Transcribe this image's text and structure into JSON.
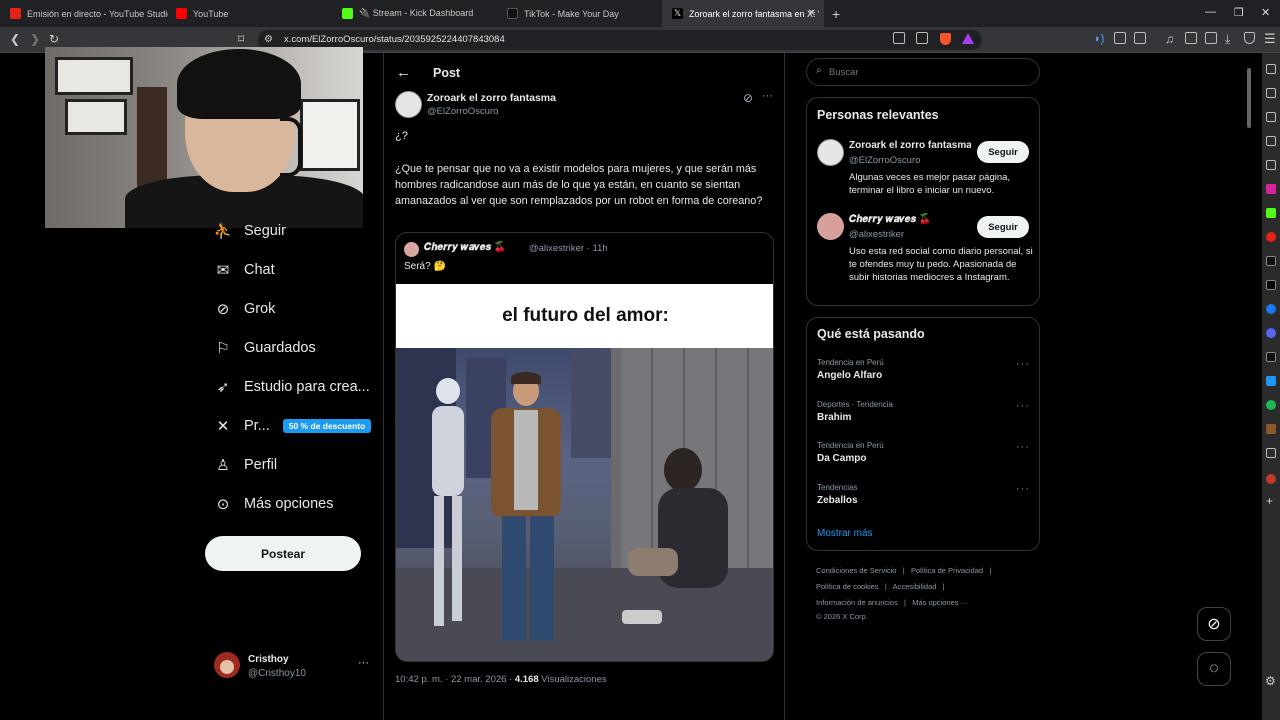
{
  "tabs": [
    {
      "label": "Emisión en directo - YouTube Studio",
      "color": "#e62117"
    },
    {
      "label": "YouTube",
      "color": "#ff0000"
    },
    {
      "label": "🔌 Stream - Kick Dashboard",
      "color": "#53fc18"
    },
    {
      "label": "TikTok - Make Your Day",
      "color": "#111111"
    },
    {
      "label": "Zoroark el zorro fantasma en X: \"",
      "color": "#000000"
    }
  ],
  "address": {
    "url": "x.com/ElZorroOscuro/status/2035925224407843084"
  },
  "nav": [
    {
      "label": "Seguir",
      "icon": "person-plus-icon"
    },
    {
      "label": "Chat",
      "icon": "mail-icon"
    },
    {
      "label": "Grok",
      "icon": "grok-icon"
    },
    {
      "label": "Guardados",
      "icon": "bookmark-icon"
    },
    {
      "label": "Estudio para crea...",
      "icon": "rocket-icon"
    },
    {
      "label": "Pr...",
      "icon": "x-logo-icon"
    },
    {
      "label": "Perfil",
      "icon": "person-icon"
    },
    {
      "label": "Más opciones",
      "icon": "more-circle-icon"
    }
  ],
  "promo_badge": "50 % de descuento",
  "post_button": "Postear",
  "account": {
    "name": "Cristhoy",
    "handle": "@Cristhoy10"
  },
  "post": {
    "header": "Post",
    "author_name": "Zoroark el zorro fantasma",
    "author_handle": "@ElZorroOscuro",
    "line1": "¿?",
    "body": "¿Que te pensar que no va a existir modelos para mujeres, y que serán más hombres radicandose aun más de lo que ya están, en cuanto se sientan amanazados al ver que son remplazados por un robot en forma de coreano?",
    "meta_time": "10:42 p. m. · 22 mar. 2026 · ",
    "views_count": "4.168",
    "views_label": " Visualizaciones"
  },
  "quote": {
    "name": "𝑪𝒉𝒆𝒓𝒓𝒚 𝒘𝒂𝒗𝒆𝒔 🍒",
    "handle_time": "@alixestriker · 11h",
    "text": "Será? 🤔",
    "image_caption": "el futuro del amor:"
  },
  "search": {
    "placeholder": "Buscar"
  },
  "relevant": {
    "title": "Personas relevantes",
    "people": [
      {
        "name": "Zoroark el zorro fantasma...",
        "handle": "@ElZorroOscuro",
        "bio": "Algunas veces es mejor pasar página, terminar el libro e iniciar un nuevo.",
        "button": "Seguir"
      },
      {
        "name": "𝑪𝒉𝒆𝒓𝒓𝒚 𝒘𝒂𝒗𝒆𝒔 🍒",
        "handle": "@alixestriker",
        "bio": "Uso esta red social como diario personal, si te ofendes muy tu pedo. Apasionada de subir historias mediocres a Instagram.",
        "button": "Seguir"
      }
    ]
  },
  "trends": {
    "title": "Qué está pasando",
    "items": [
      {
        "context": "Tendencia en Perú",
        "name": "Angelo Alfaro"
      },
      {
        "context": "Deportes · Tendencia",
        "name": "Brahim"
      },
      {
        "context": "Tendencia en Perú",
        "name": "Da Campo"
      },
      {
        "context": "Tendencias",
        "name": "Zeballos"
      }
    ],
    "show_more": "Mostrar más"
  },
  "footer": {
    "row1": [
      "Condiciones de Servicio",
      "|",
      "Política de Privacidad",
      "|"
    ],
    "row2": [
      "Política de cookies",
      "|",
      "Accesibilidad",
      "|"
    ],
    "row3": [
      "Información de anuncios",
      "|",
      "Más opciones ···"
    ],
    "copyright": "© 2026 X Corp."
  }
}
